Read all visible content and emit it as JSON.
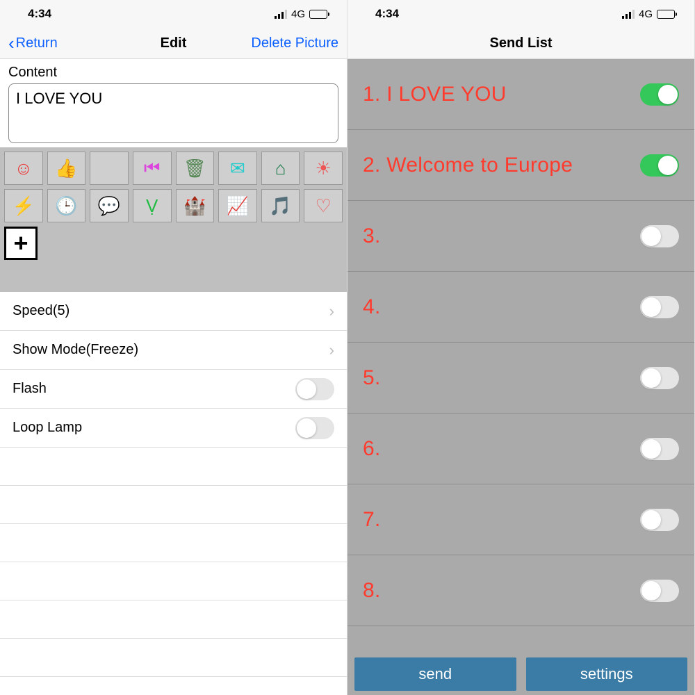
{
  "status": {
    "time": "4:34",
    "network": "4G"
  },
  "left": {
    "nav": {
      "back": "Return",
      "title": "Edit",
      "right": "Delete Picture"
    },
    "content_label": "Content",
    "content_value": "I LOVE YOU",
    "icons": [
      {
        "name": "face-icon",
        "glyph": "☺",
        "color": "#e33"
      },
      {
        "name": "thumbs-up-icon",
        "glyph": "👍",
        "color": "#7a3"
      },
      {
        "name": "apple-icon",
        "glyph": "",
        "color": "#3c3"
      },
      {
        "name": "prev-track-icon",
        "glyph": "⏮",
        "color": "#d4d"
      },
      {
        "name": "trash-icon",
        "glyph": "🗑",
        "color": "#585"
      },
      {
        "name": "mail-icon",
        "glyph": "✉",
        "color": "#2cc"
      },
      {
        "name": "home-icon",
        "glyph": "⌂",
        "color": "#174"
      },
      {
        "name": "sun-icon",
        "glyph": "☀",
        "color": "#e55"
      },
      {
        "name": "bolt-icon",
        "glyph": "⚡",
        "color": "#33d"
      },
      {
        "name": "clock-icon",
        "glyph": "🕒",
        "color": "#e44"
      },
      {
        "name": "chat-icon",
        "glyph": "💬",
        "color": "#26b"
      },
      {
        "name": "cart-icon",
        "glyph": "Ṿ",
        "color": "#2b4"
      },
      {
        "name": "castle-icon",
        "glyph": "🏰",
        "color": "#e33"
      },
      {
        "name": "chart-icon",
        "glyph": "📈",
        "color": "#111"
      },
      {
        "name": "music-icon",
        "glyph": "🎵",
        "color": "#d4d"
      },
      {
        "name": "heart-icon",
        "glyph": "♡",
        "color": "#e55"
      }
    ],
    "settings": {
      "speed_label": "Speed(5)",
      "mode_label": "Show Mode(Freeze)",
      "flash_label": "Flash",
      "loop_label": "Loop Lamp",
      "flash_on": false,
      "loop_on": false
    }
  },
  "right": {
    "nav_title": "Send List",
    "items": [
      {
        "label": "1. I LOVE YOU",
        "on": true
      },
      {
        "label": "2. Welcome to Europe",
        "on": true
      },
      {
        "label": "3.",
        "on": false
      },
      {
        "label": "4.",
        "on": false
      },
      {
        "label": "5.",
        "on": false
      },
      {
        "label": "6.",
        "on": false
      },
      {
        "label": "7.",
        "on": false
      },
      {
        "label": "8.",
        "on": false
      }
    ],
    "buttons": {
      "send": "send",
      "settings": "settings"
    }
  }
}
